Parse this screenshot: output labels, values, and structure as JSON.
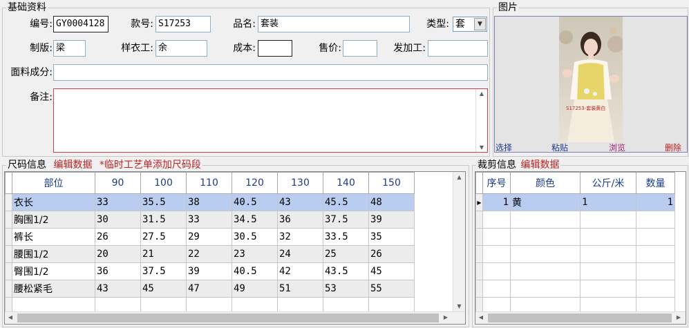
{
  "basic": {
    "title": "基础资料",
    "code_label": "编号:",
    "code_value": "GY0004128",
    "style_label": "款号:",
    "style_value": "S17253",
    "name_label": "品名:",
    "name_value": "套装",
    "type_label": "类型:",
    "type_value": "套",
    "maker_label": "制版:",
    "maker_value": "梁",
    "sample_label": "样衣工:",
    "sample_value": "余",
    "cost_label": "成本:",
    "cost_value": "",
    "price_label": "售价:",
    "price_value": "",
    "process_label": "发加工:",
    "process_value": "",
    "fabric_label": "面料成分:",
    "fabric_value": "",
    "note_label": "备注:",
    "note_value": ""
  },
  "picture": {
    "title": "图片",
    "overlay_text": "S17253-套装黄白",
    "select": "选择",
    "paste": "粘贴",
    "browse": "浏览",
    "delete": "删除"
  },
  "size": {
    "title": "尺码信息",
    "edit": "编辑数据",
    "hint": "*临时工艺单添加尺码段",
    "headers": [
      "部位",
      "90",
      "100",
      "110",
      "120",
      "130",
      "140",
      "150"
    ],
    "rows": [
      [
        "衣长",
        "33",
        "35.5",
        "38",
        "40.5",
        "43",
        "45.5",
        "48"
      ],
      [
        "胸围1/2",
        "30",
        "31.5",
        "33",
        "34.5",
        "36",
        "37.5",
        "39"
      ],
      [
        "裤长",
        "26",
        "27.5",
        "29",
        "30.5",
        "32",
        "33.5",
        "35"
      ],
      [
        "腰围1/2",
        "20",
        "21",
        "22",
        "23",
        "24",
        "25",
        "26"
      ],
      [
        "臀围1/2",
        "36",
        "37.5",
        "39",
        "40.5",
        "42",
        "43.5",
        "45"
      ],
      [
        "腰松紧毛",
        "43",
        "45",
        "47",
        "49",
        "51",
        "53",
        "55"
      ]
    ]
  },
  "cut": {
    "title": "裁剪信息",
    "edit": "编辑数据",
    "headers": [
      "序号",
      "颜色",
      "公斤/米",
      "数量"
    ],
    "rows": [
      [
        "1",
        "黄",
        "1",
        "1"
      ]
    ]
  },
  "colors": {
    "accent_red": "#c02020",
    "selected_row": "#b8cdf0",
    "header_blue": "#1a3a8a"
  }
}
